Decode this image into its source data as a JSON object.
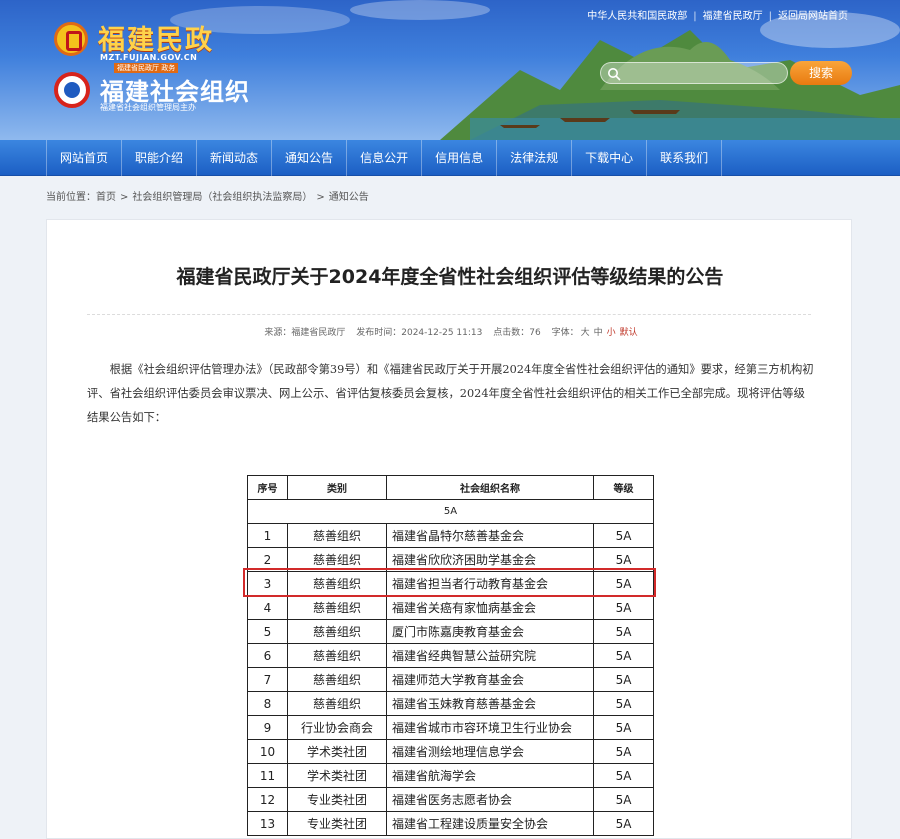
{
  "top_links": [
    "中华人民共和国民政部",
    "福建省民政厅",
    "返回局网站首页"
  ],
  "logo1": {
    "title": "福建民政",
    "domain": "MZT.FUJIAN.GOV.CN",
    "sub": "福建省民政厅 政务"
  },
  "logo2": {
    "title": "福建社会组织",
    "sub": "福建省社会组织管理局主办"
  },
  "search": {
    "placeholder": "",
    "button": "搜索"
  },
  "nav": [
    "网站首页",
    "职能介绍",
    "新闻动态",
    "通知公告",
    "信息公开",
    "信用信息",
    "法律法规",
    "下载中心",
    "联系我们"
  ],
  "breadcrumb": {
    "label": "当前位置：",
    "items": [
      "首页",
      "社会组织管理局（社会组织执法监察局）",
      "通知公告"
    ]
  },
  "article": {
    "title": "福建省民政厅关于2024年度全省性社会组织评估等级结果的公告",
    "meta": {
      "source": "来源：福建省民政厅",
      "date": "发布时间：2024-12-25 11:13",
      "clicks": "点击数：76",
      "font_label": "字体：",
      "large": "大",
      "medium": "中",
      "small": "小",
      "default": "默认"
    },
    "body": "根据《社会组织评估管理办法》（民政部令第39号）和《福建省民政厅关于开展2024年度全省性社会组织评估的通知》要求，经第三方机构初评、省社会组织评估委员会审议票决、网上公示、省评估复核委员会复核，2024年度全省性社会组织评估的相关工作已全部完成。现将评估等级结果公告如下："
  },
  "table": {
    "headers": [
      "序号",
      "类别",
      "社会组织名称",
      "等级"
    ],
    "group": "5A",
    "rows": [
      [
        "1",
        "慈善组织",
        "福建省晶特尔慈善基金会",
        "5A"
      ],
      [
        "2",
        "慈善组织",
        "福建省欣欣济困助学基金会",
        "5A"
      ],
      [
        "3",
        "慈善组织",
        "福建省担当者行动教育基金会",
        "5A"
      ],
      [
        "4",
        "慈善组织",
        "福建省关癌有家恤病基金会",
        "5A"
      ],
      [
        "5",
        "慈善组织",
        "厦门市陈嘉庚教育基金会",
        "5A"
      ],
      [
        "6",
        "慈善组织",
        "福建省经典智慧公益研究院",
        "5A"
      ],
      [
        "7",
        "慈善组织",
        "福建师范大学教育基金会",
        "5A"
      ],
      [
        "8",
        "慈善组织",
        "福建省玉妹教育慈善基金会",
        "5A"
      ],
      [
        "9",
        "行业协会商会",
        "福建省城市市容环境卫生行业协会",
        "5A"
      ],
      [
        "10",
        "学术类社团",
        "福建省测绘地理信息学会",
        "5A"
      ],
      [
        "11",
        "学术类社团",
        "福建省航海学会",
        "5A"
      ],
      [
        "12",
        "专业类社团",
        "福建省医务志愿者协会",
        "5A"
      ],
      [
        "13",
        "专业类社团",
        "福建省工程建设质量安全协会",
        "5A"
      ]
    ],
    "highlighted_row": 3
  }
}
